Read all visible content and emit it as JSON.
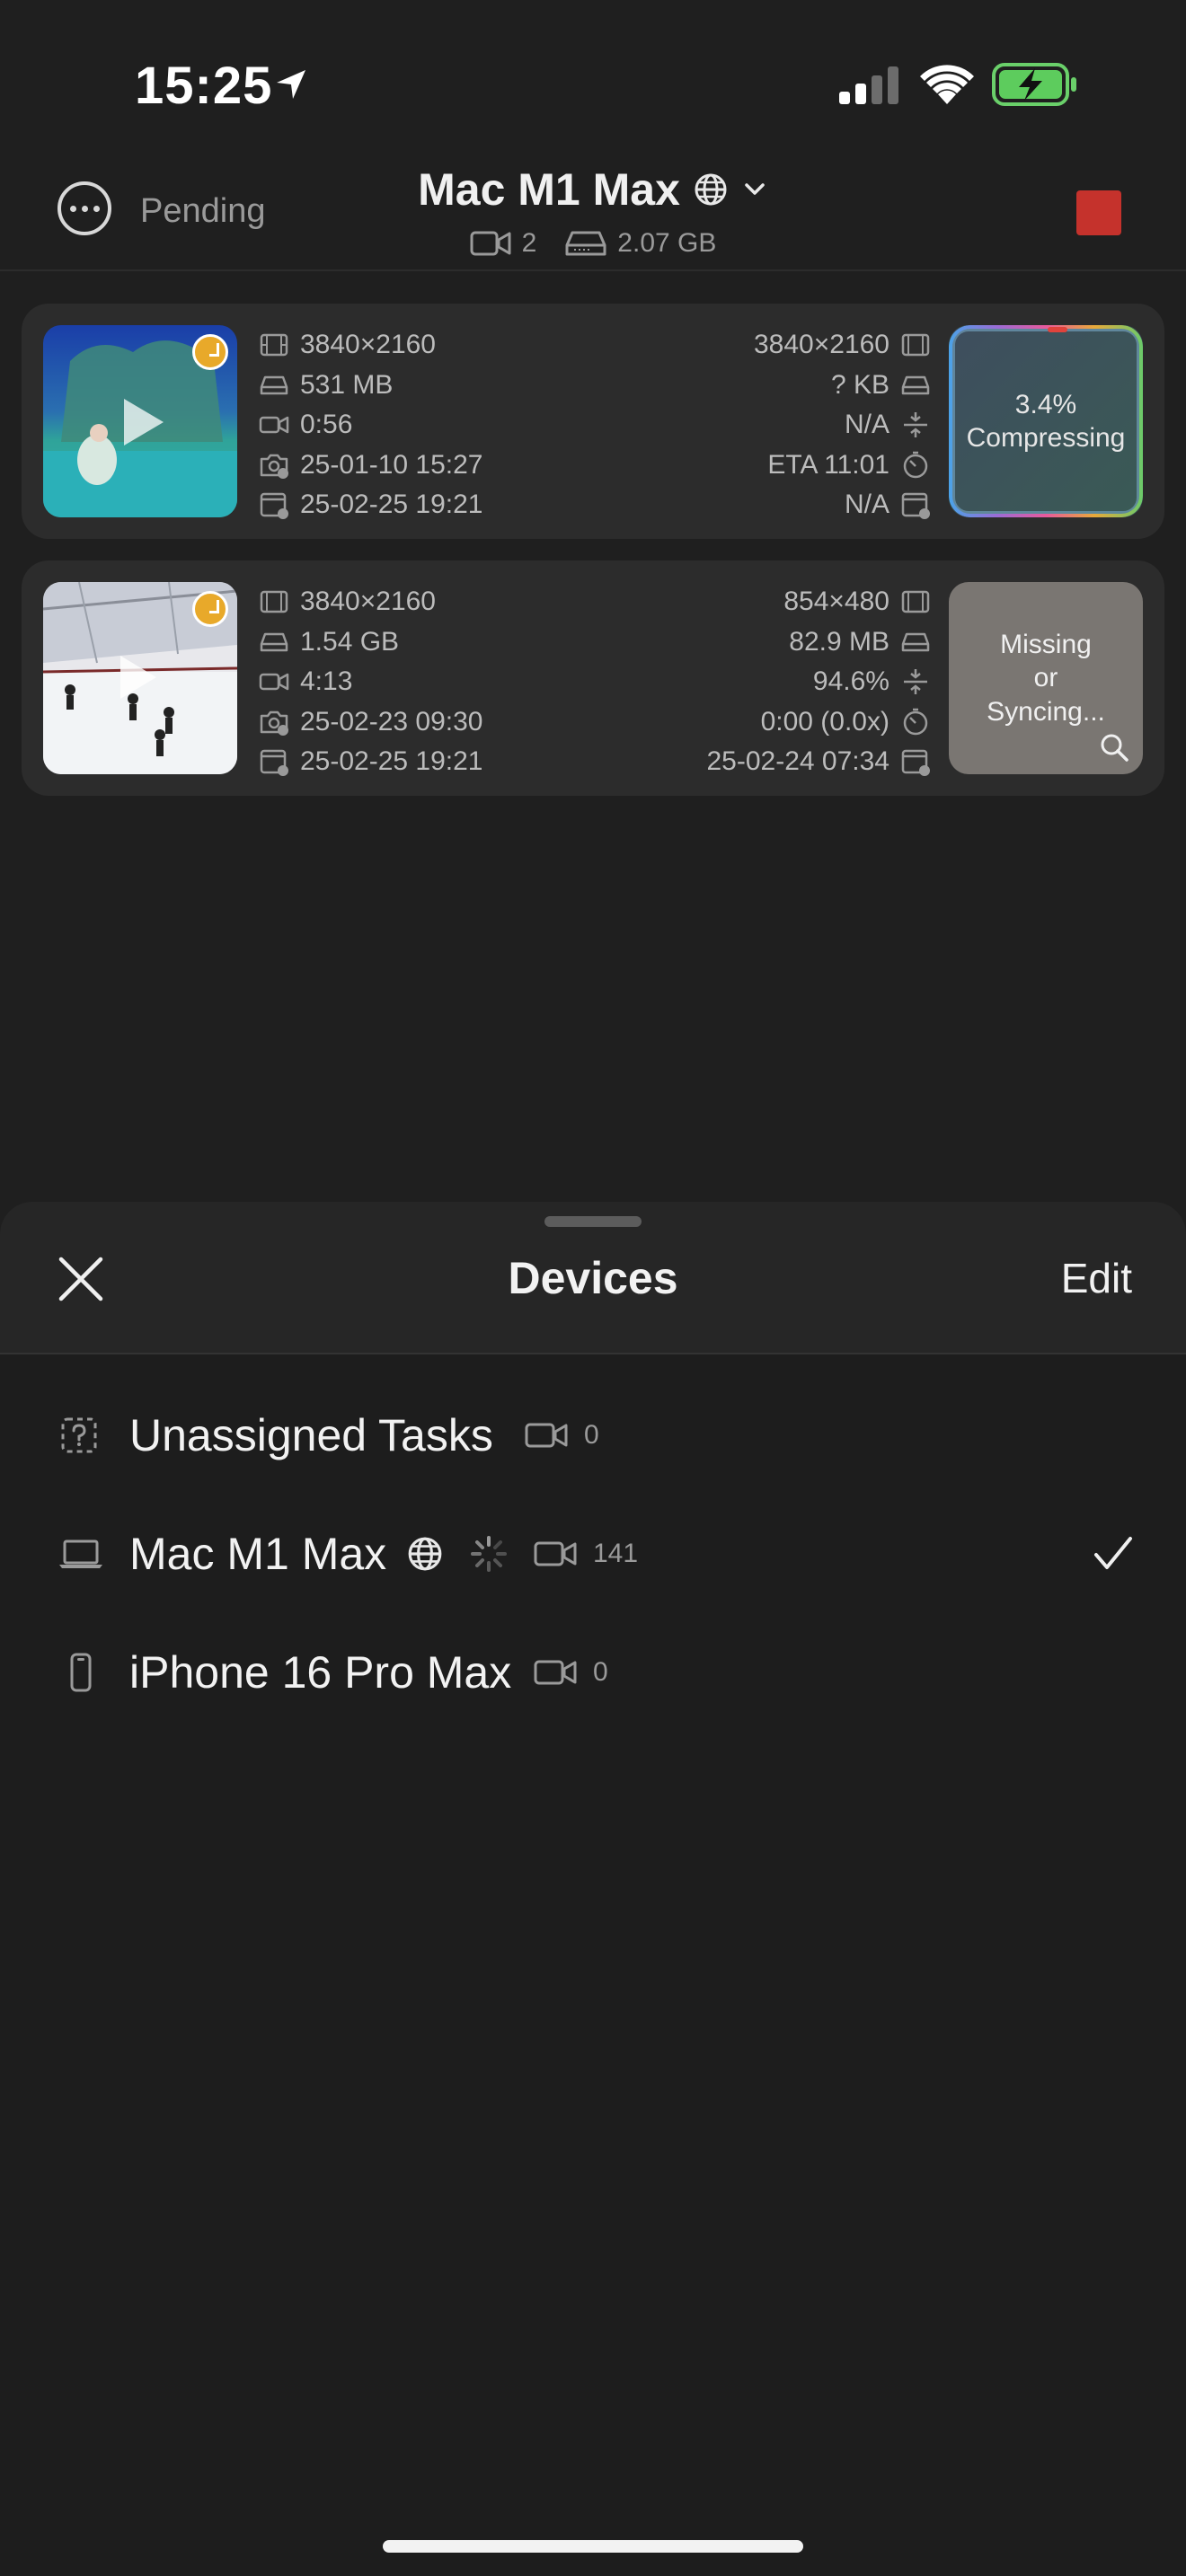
{
  "status_bar": {
    "time": "15:25",
    "icons": [
      "location-arrow-icon",
      "cellular-signal-icon",
      "wifi-icon",
      "battery-charging-icon"
    ]
  },
  "header": {
    "status_label": "Pending",
    "device_title": "Mac M1 Max",
    "video_count": "2",
    "total_size": "2.07 GB",
    "stop_color": "#c5322c"
  },
  "tasks": [
    {
      "source": {
        "resolution": "3840×2160",
        "size": "531 MB",
        "duration": "0:56",
        "captured": "25-01-10 15:27",
        "added": "25-02-25 19:21"
      },
      "output": {
        "resolution": "3840×2160",
        "size": "? KB",
        "ratio": "N/A",
        "time": "ETA 11:01",
        "finished": "N/A"
      },
      "status_percent": "3.4%",
      "status_text": "Compressing",
      "progress": 0.034
    },
    {
      "source": {
        "resolution": "3840×2160",
        "size": "1.54 GB",
        "duration": "4:13",
        "captured": "25-02-23 09:30",
        "added": "25-02-25 19:21"
      },
      "output": {
        "resolution": "854×480",
        "size": "82.9 MB",
        "ratio": "94.6%",
        "time": "0:00 (0.0x)",
        "finished": "25-02-24 07:34"
      },
      "status_lines": [
        "Missing",
        "or",
        "Syncing..."
      ]
    }
  ],
  "sheet": {
    "title": "Devices",
    "edit_label": "Edit",
    "devices": [
      {
        "name": "Unassigned Tasks",
        "count": "0",
        "icon": "question-box-icon"
      },
      {
        "name": "Mac M1 Max",
        "count": "141",
        "icon": "laptop-icon",
        "selected": true
      },
      {
        "name": "iPhone 16 Pro Max",
        "count": "0",
        "icon": "iphone-icon"
      }
    ]
  }
}
